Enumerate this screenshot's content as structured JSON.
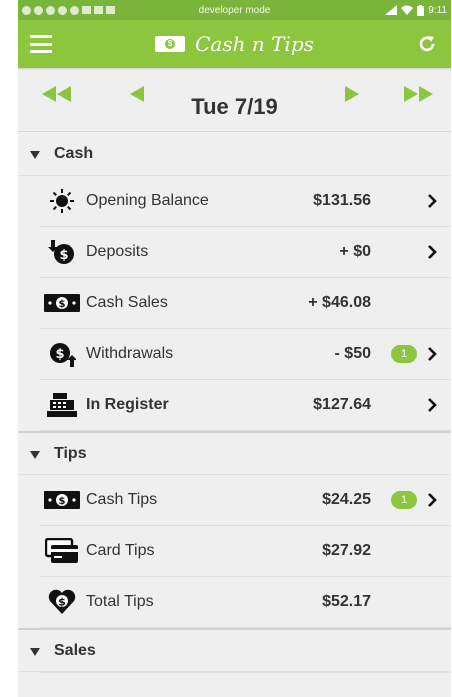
{
  "status_bar": {
    "mode_text": "developer mode",
    "time": "9:11"
  },
  "app_bar": {
    "title": "Cash n Tips",
    "menu_icon": "hamburger-menu-icon",
    "refresh_icon": "refresh-icon"
  },
  "date_nav": {
    "date": "Tue 7/19",
    "icons": [
      "double-left-arrow-icon",
      "left-arrow-icon",
      "right-arrow-icon",
      "double-right-arrow-icon"
    ]
  },
  "sections": {
    "cash": {
      "title": "Cash",
      "rows": [
        {
          "label": "Opening Balance",
          "value": "$131.56",
          "icon": "sun-icon",
          "chevron": true
        },
        {
          "label": "Deposits",
          "value": "+ $0",
          "icon": "deposit-icon",
          "chevron": true
        },
        {
          "label": "Cash Sales",
          "value": "+ $46.08",
          "icon": "cash-bill-icon",
          "chevron": false
        },
        {
          "label": "Withdrawals",
          "value": "- $50",
          "icon": "withdrawal-icon",
          "badge": "1",
          "chevron": true
        },
        {
          "label": "In Register",
          "value": "$127.64",
          "icon": "cash-register-icon",
          "chevron": true
        }
      ]
    },
    "tips": {
      "title": "Tips",
      "rows": [
        {
          "label": "Cash Tips",
          "value": "$24.25",
          "icon": "cash-bill-icon",
          "badge": "1",
          "chevron": true
        },
        {
          "label": "Card Tips",
          "value": "$27.92",
          "icon": "credit-card-icon",
          "chevron": false
        },
        {
          "label": "Total Tips",
          "value": "$52.17",
          "icon": "heart-dollar-icon",
          "chevron": false
        }
      ]
    },
    "sales": {
      "title": "Sales"
    }
  },
  "colors": {
    "status_bar": "#7bb43a",
    "app_bar": "#8cc63f",
    "accent": "#8cc63f",
    "background": "#efefef"
  }
}
